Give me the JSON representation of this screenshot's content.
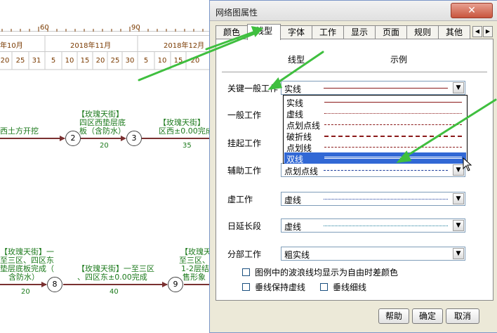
{
  "schedule": {
    "scale_numbers": [
      "60",
      "90"
    ],
    "months": [
      "年10月",
      "2018年11月",
      "2018年12月"
    ],
    "days": [
      "20",
      "25",
      "31",
      "5",
      "10",
      "15",
      "20",
      "25",
      "30",
      "5",
      "10",
      "15",
      "20"
    ],
    "tasks": {
      "t1": "西土方开挖",
      "t2_l1": "【玫瑰天街】",
      "t2_l2": "四区西垫层底",
      "t2_l3": "板（含防水）",
      "t3_l1": "【玫瑰天街】",
      "t3_l2": "区西±0.00完成",
      "t4_l1": "【玫瑰天街】一",
      "t4_l2": "至三区、四区东",
      "t4_l3": "垫层底板完成（",
      "t4_l4": "含防水）",
      "t5_l1": "【玫瑰天街】一至三区",
      "t5_l2": "、四区东±0.00完成",
      "t6_l1": "【玫瑰天街】",
      "t6_l2": "至三区、四区",
      "t6_l3": "1-2层结",
      "t6_l4": "售形象"
    },
    "nodes": [
      "2",
      "3",
      "8",
      "9"
    ],
    "durations": [
      "20",
      "35",
      "20",
      "40"
    ]
  },
  "dialog": {
    "title": "网络图属性",
    "close_label": "✕",
    "tabs": [
      "颜色",
      "线型",
      "字体",
      "工作",
      "显示",
      "页面",
      "规则",
      "其他"
    ],
    "active_tab": 1,
    "col_headers": {
      "type": "线型",
      "sample": "示例"
    },
    "fields": [
      {
        "label": "关键一般工作",
        "value": "实线",
        "style": "solid-brown"
      },
      {
        "label": "一般工作",
        "value": "",
        "style": ""
      },
      {
        "label": "挂起工作",
        "value": "",
        "style": ""
      },
      {
        "label": "辅助工作",
        "value": "点划点线",
        "style": "dashdot-blue"
      },
      {
        "label": "虚工作",
        "value": "虚线",
        "style": "dotted-blue"
      },
      {
        "label": "日延长段",
        "value": "虚线",
        "style": "dotted-teal"
      },
      {
        "label": "分部工作",
        "value": "粗实线",
        "style": "none"
      }
    ],
    "dropdown_options": [
      {
        "label": "实线",
        "style": "solid"
      },
      {
        "label": "虚线",
        "style": "dotted"
      },
      {
        "label": "点划点线",
        "style": "dashdot"
      },
      {
        "label": "破折线",
        "style": "dashed"
      },
      {
        "label": "点划线",
        "style": "dashdot2"
      },
      {
        "label": "双线",
        "style": "double"
      }
    ],
    "selected_option": 5,
    "checkboxes": [
      {
        "label": "图例中的波浪线均显示为自由时差颜色",
        "checked": false
      },
      {
        "label": "垂线保持虚线",
        "checked": false
      },
      {
        "label": "垂线细线",
        "checked": false
      }
    ],
    "buttons": {
      "help": "帮助",
      "ok": "确定",
      "cancel": "取消"
    }
  },
  "colors": {
    "accent_selection": "#3168d5",
    "task_text": "#1c7a1c",
    "arrow_green": "#3fbf3f",
    "link_line": "#7a3030"
  }
}
